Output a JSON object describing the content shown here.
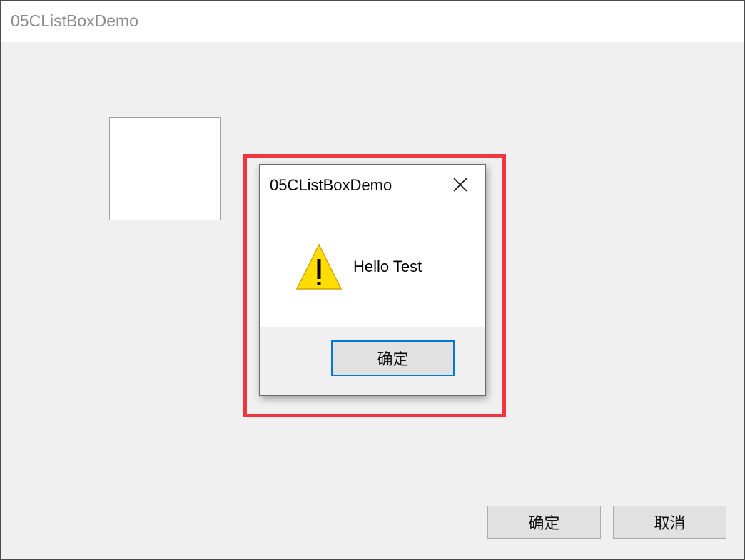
{
  "main_window": {
    "title": "05CListBoxDemo",
    "ok_label": "确定",
    "cancel_label": "取消"
  },
  "message_box": {
    "title": "05CListBoxDemo",
    "message": "Hello Test",
    "ok_label": "确定",
    "icon": "warning-icon",
    "close_icon": "close-icon"
  },
  "colors": {
    "highlight": "#f2363f",
    "focus_border": "#0078d7",
    "warning_fill": "#ffdd00"
  }
}
